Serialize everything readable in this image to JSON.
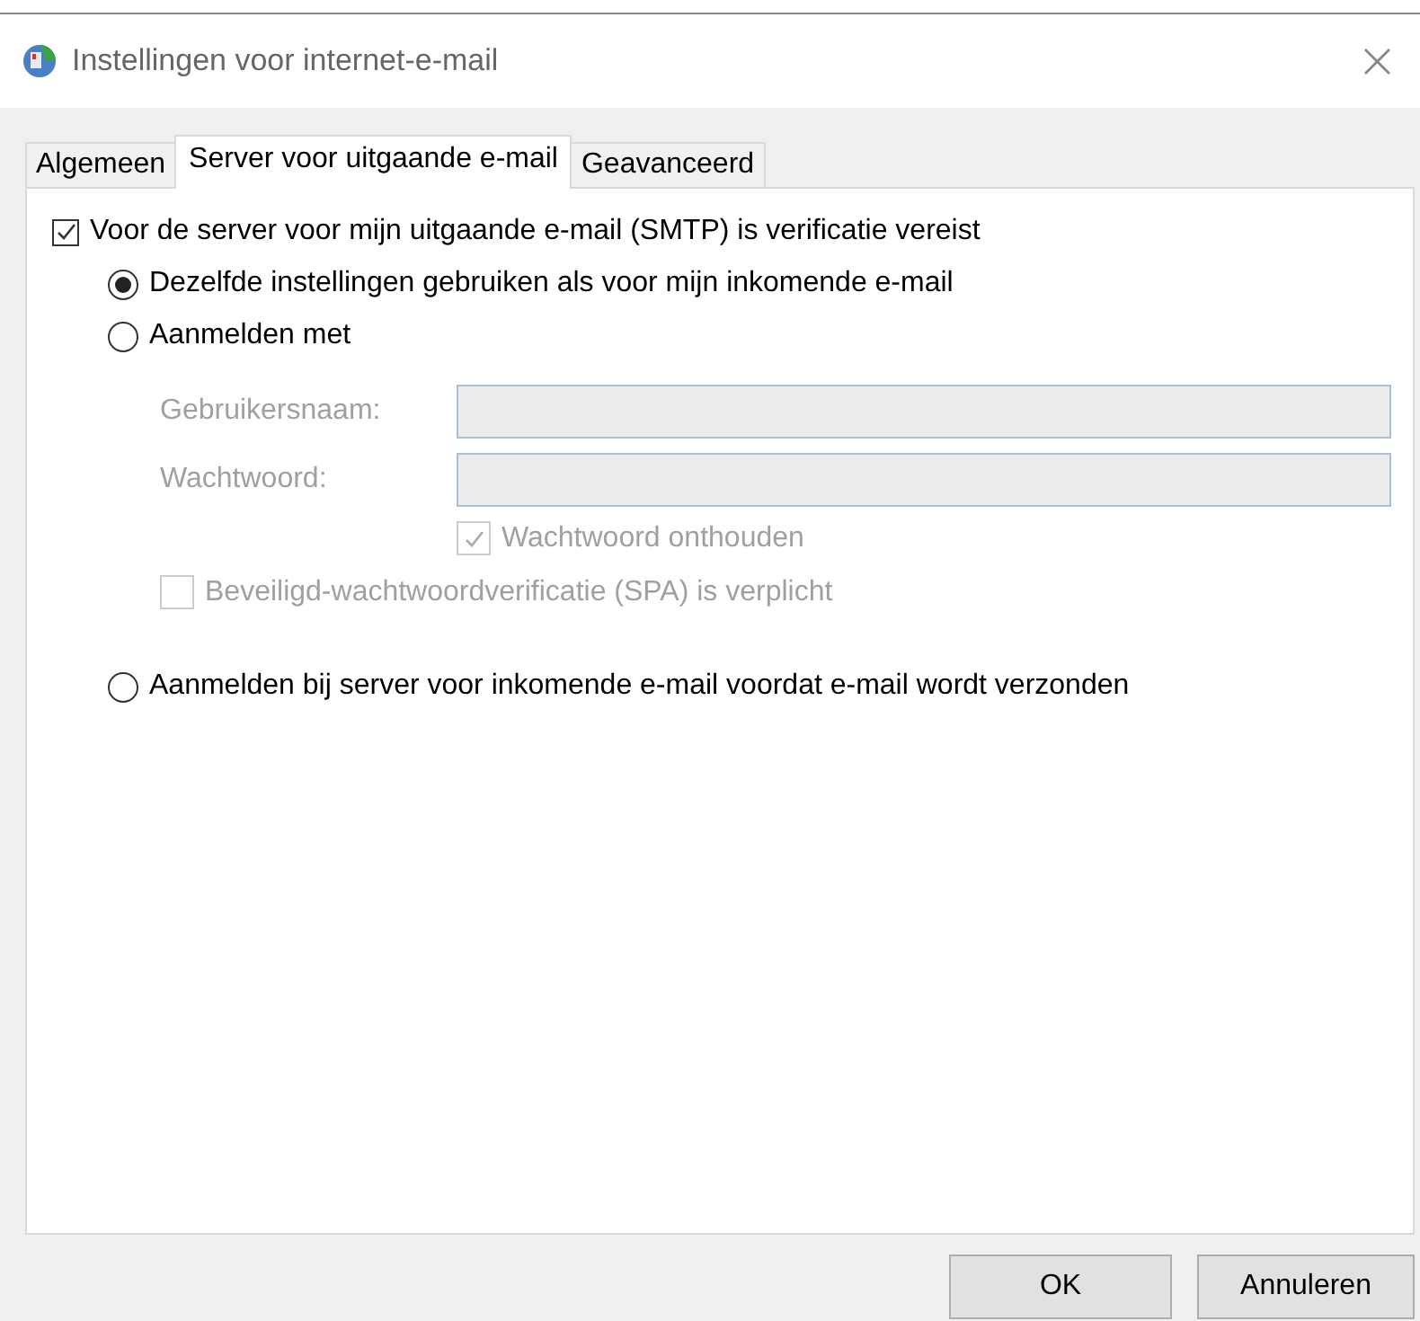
{
  "window": {
    "title": "Instellingen voor internet-e-mail",
    "close": "×"
  },
  "tabs": [
    {
      "label": "Algemeen",
      "selected": false
    },
    {
      "label": "Server voor uitgaande e-mail",
      "selected": true
    },
    {
      "label": "Geavanceerd",
      "selected": false
    }
  ],
  "auth_required": {
    "label": "Voor de server voor mijn uitgaande e-mail (SMTP) is verificatie vereist",
    "checked": true
  },
  "options": [
    {
      "label": "Dezelfde instellingen gebruiken als voor mijn inkomende e-mail",
      "selected": true,
      "kind": "plain"
    },
    {
      "label": "Aanmelden met",
      "selected": false,
      "kind": "credentials"
    },
    {
      "label": "Aanmelden bij server voor inkomende e-mail voordat e-mail wordt verzonden",
      "selected": false,
      "kind": "plain"
    }
  ],
  "credentials": {
    "disabled": true,
    "fields": [
      {
        "label": "Gebruikersnaam:"
      },
      {
        "label": "Wachtwoord:"
      }
    ],
    "remember": {
      "label": "Wachtwoord onthouden",
      "checked": true
    },
    "spa": {
      "label": "Beveiligd-wachtwoordverificatie (SPA) is verplicht",
      "checked": false
    }
  },
  "buttons": [
    "OK",
    "Annuleren"
  ]
}
